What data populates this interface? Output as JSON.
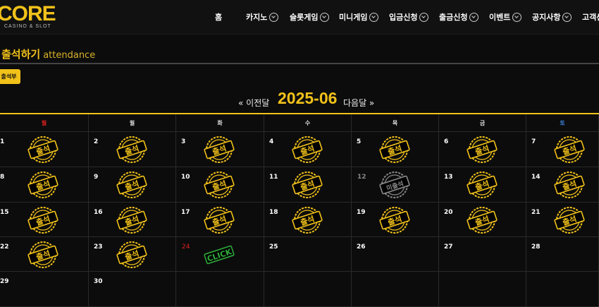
{
  "header": {
    "logo_text": "CORE",
    "logo_sub": "CASINO & SLOT",
    "nav": [
      {
        "label": "홈",
        "dropdown": false
      },
      {
        "label": "카지노",
        "dropdown": true
      },
      {
        "label": "슬롯게임",
        "dropdown": true
      },
      {
        "label": "미니게임",
        "dropdown": true
      },
      {
        "label": "입금신청",
        "dropdown": true
      },
      {
        "label": "출금신청",
        "dropdown": true
      },
      {
        "label": "이벤트",
        "dropdown": true
      },
      {
        "label": "공지사항",
        "dropdown": true
      },
      {
        "label": "고객센",
        "dropdown": false
      }
    ]
  },
  "page": {
    "title": "출석하기",
    "title_en": "attendance",
    "register_button": "출석부"
  },
  "month_nav": {
    "prev": "« 이전달",
    "current": "2025-06",
    "next": "다음달 »"
  },
  "calendar": {
    "weekdays": [
      "월",
      "월",
      "화",
      "수",
      "목",
      "금",
      "토"
    ],
    "weekday_colors": [
      "#e02020",
      "#dddddd",
      "#dddddd",
      "#dddddd",
      "#dddddd",
      "#dddddd",
      "#3a7fd5"
    ],
    "weeks": [
      [
        {
          "day": "1",
          "stamp": "출석"
        },
        {
          "day": "2",
          "stamp": "출석"
        },
        {
          "day": "3",
          "stamp": "출석"
        },
        {
          "day": "4",
          "stamp": "출석"
        },
        {
          "day": "5",
          "stamp": "출석"
        },
        {
          "day": "6",
          "stamp": "출석"
        },
        {
          "day": "7",
          "stamp": "출석"
        }
      ],
      [
        {
          "day": "8",
          "stamp": "출석"
        },
        {
          "day": "9",
          "stamp": "출석"
        },
        {
          "day": "10",
          "stamp": "출석"
        },
        {
          "day": "11",
          "stamp": "출석"
        },
        {
          "day": "12",
          "stamp": "미출석",
          "muted": true
        },
        {
          "day": "13",
          "stamp": "출석"
        },
        {
          "day": "14",
          "stamp": "출석"
        }
      ],
      [
        {
          "day": "15",
          "stamp": "출석"
        },
        {
          "day": "16",
          "stamp": "출석"
        },
        {
          "day": "17",
          "stamp": "출석"
        },
        {
          "day": "18",
          "stamp": "출석"
        },
        {
          "day": "19",
          "stamp": "출석"
        },
        {
          "day": "20",
          "stamp": "출석"
        },
        {
          "day": "21",
          "stamp": "출석"
        }
      ],
      [
        {
          "day": "22",
          "stamp": "출석"
        },
        {
          "day": "23",
          "stamp": "출석"
        },
        {
          "day": "24",
          "stamp": "CLICK",
          "today": true
        },
        {
          "day": "25",
          "stamp": ""
        },
        {
          "day": "26",
          "stamp": ""
        },
        {
          "day": "27",
          "stamp": ""
        },
        {
          "day": "28",
          "stamp": ""
        }
      ],
      [
        {
          "day": "29",
          "stamp": ""
        },
        {
          "day": "30",
          "stamp": ""
        },
        {
          "day": "",
          "stamp": ""
        },
        {
          "day": "",
          "stamp": ""
        },
        {
          "day": "",
          "stamp": ""
        },
        {
          "day": "",
          "stamp": ""
        },
        {
          "day": "",
          "stamp": ""
        }
      ]
    ]
  },
  "colors": {
    "accent": "#f2c21a",
    "today": "#e02020",
    "click_stamp": "#2faa3a",
    "missed_stamp": "#888888"
  },
  "icons": {
    "nav_dropdown": "chevron-circle-down-icon",
    "attend_stamp": "attendance-stamp-icon",
    "missed_stamp": "absent-stamp-icon",
    "click_stamp": "click-stamp-icon"
  }
}
